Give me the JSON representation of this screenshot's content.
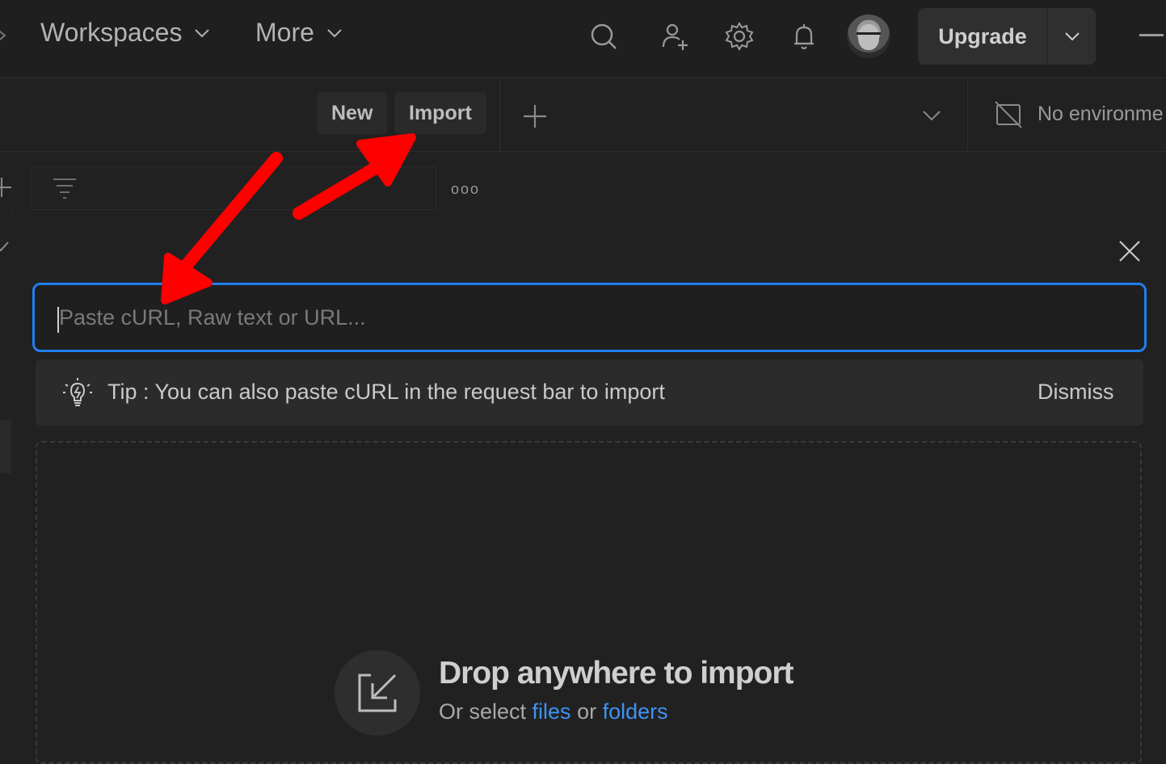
{
  "topbar": {
    "workspaces_label": "Workspaces",
    "more_label": "More",
    "upgrade_label": "Upgrade",
    "icons": [
      "search-icon",
      "invite-user-icon",
      "settings-icon",
      "notifications-icon"
    ]
  },
  "subbar": {
    "new_label": "New",
    "import_label": "Import",
    "environment_label": "No environme"
  },
  "sidebar": {
    "more_label": "ooo"
  },
  "import_modal": {
    "input_placeholder": "Paste cURL, Raw text or URL...",
    "input_value": "",
    "tip_text": "Tip : You can also paste cURL in the request bar to import",
    "dismiss_label": "Dismiss",
    "drop_title": "Drop anywhere to import",
    "drop_sub_prefix": "Or select",
    "files_link": "files",
    "drop_sub_middle": "or",
    "folders_link": "folders"
  },
  "colors": {
    "background": "#212121",
    "accent_blue": "#1f7ff0",
    "link_blue": "#3d93f5",
    "annotation_red": "#ff0000"
  }
}
